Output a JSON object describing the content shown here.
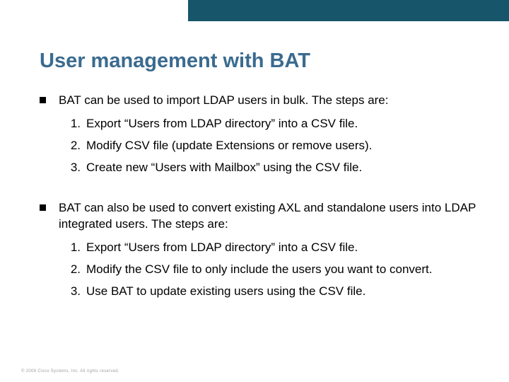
{
  "title": "User management with BAT",
  "blocks": [
    {
      "lead": "BAT can be used to import LDAP users in bulk. The steps are:",
      "steps": [
        "Export “Users from LDAP directory” into a CSV file.",
        "Modify CSV file (update Extensions or remove users).",
        "Create new “Users with Mailbox” using the CSV file."
      ]
    },
    {
      "lead": "BAT can also be used to convert existing AXL and standalone users into LDAP integrated users. The steps are:",
      "steps": [
        "Export “Users from LDAP directory” into a CSV file.",
        "Modify the CSV file to only include the users you want to convert.",
        "Use BAT to update existing users using the CSV file."
      ]
    }
  ],
  "footer": "© 2008 Cisco Systems, Inc. All rights reserved."
}
